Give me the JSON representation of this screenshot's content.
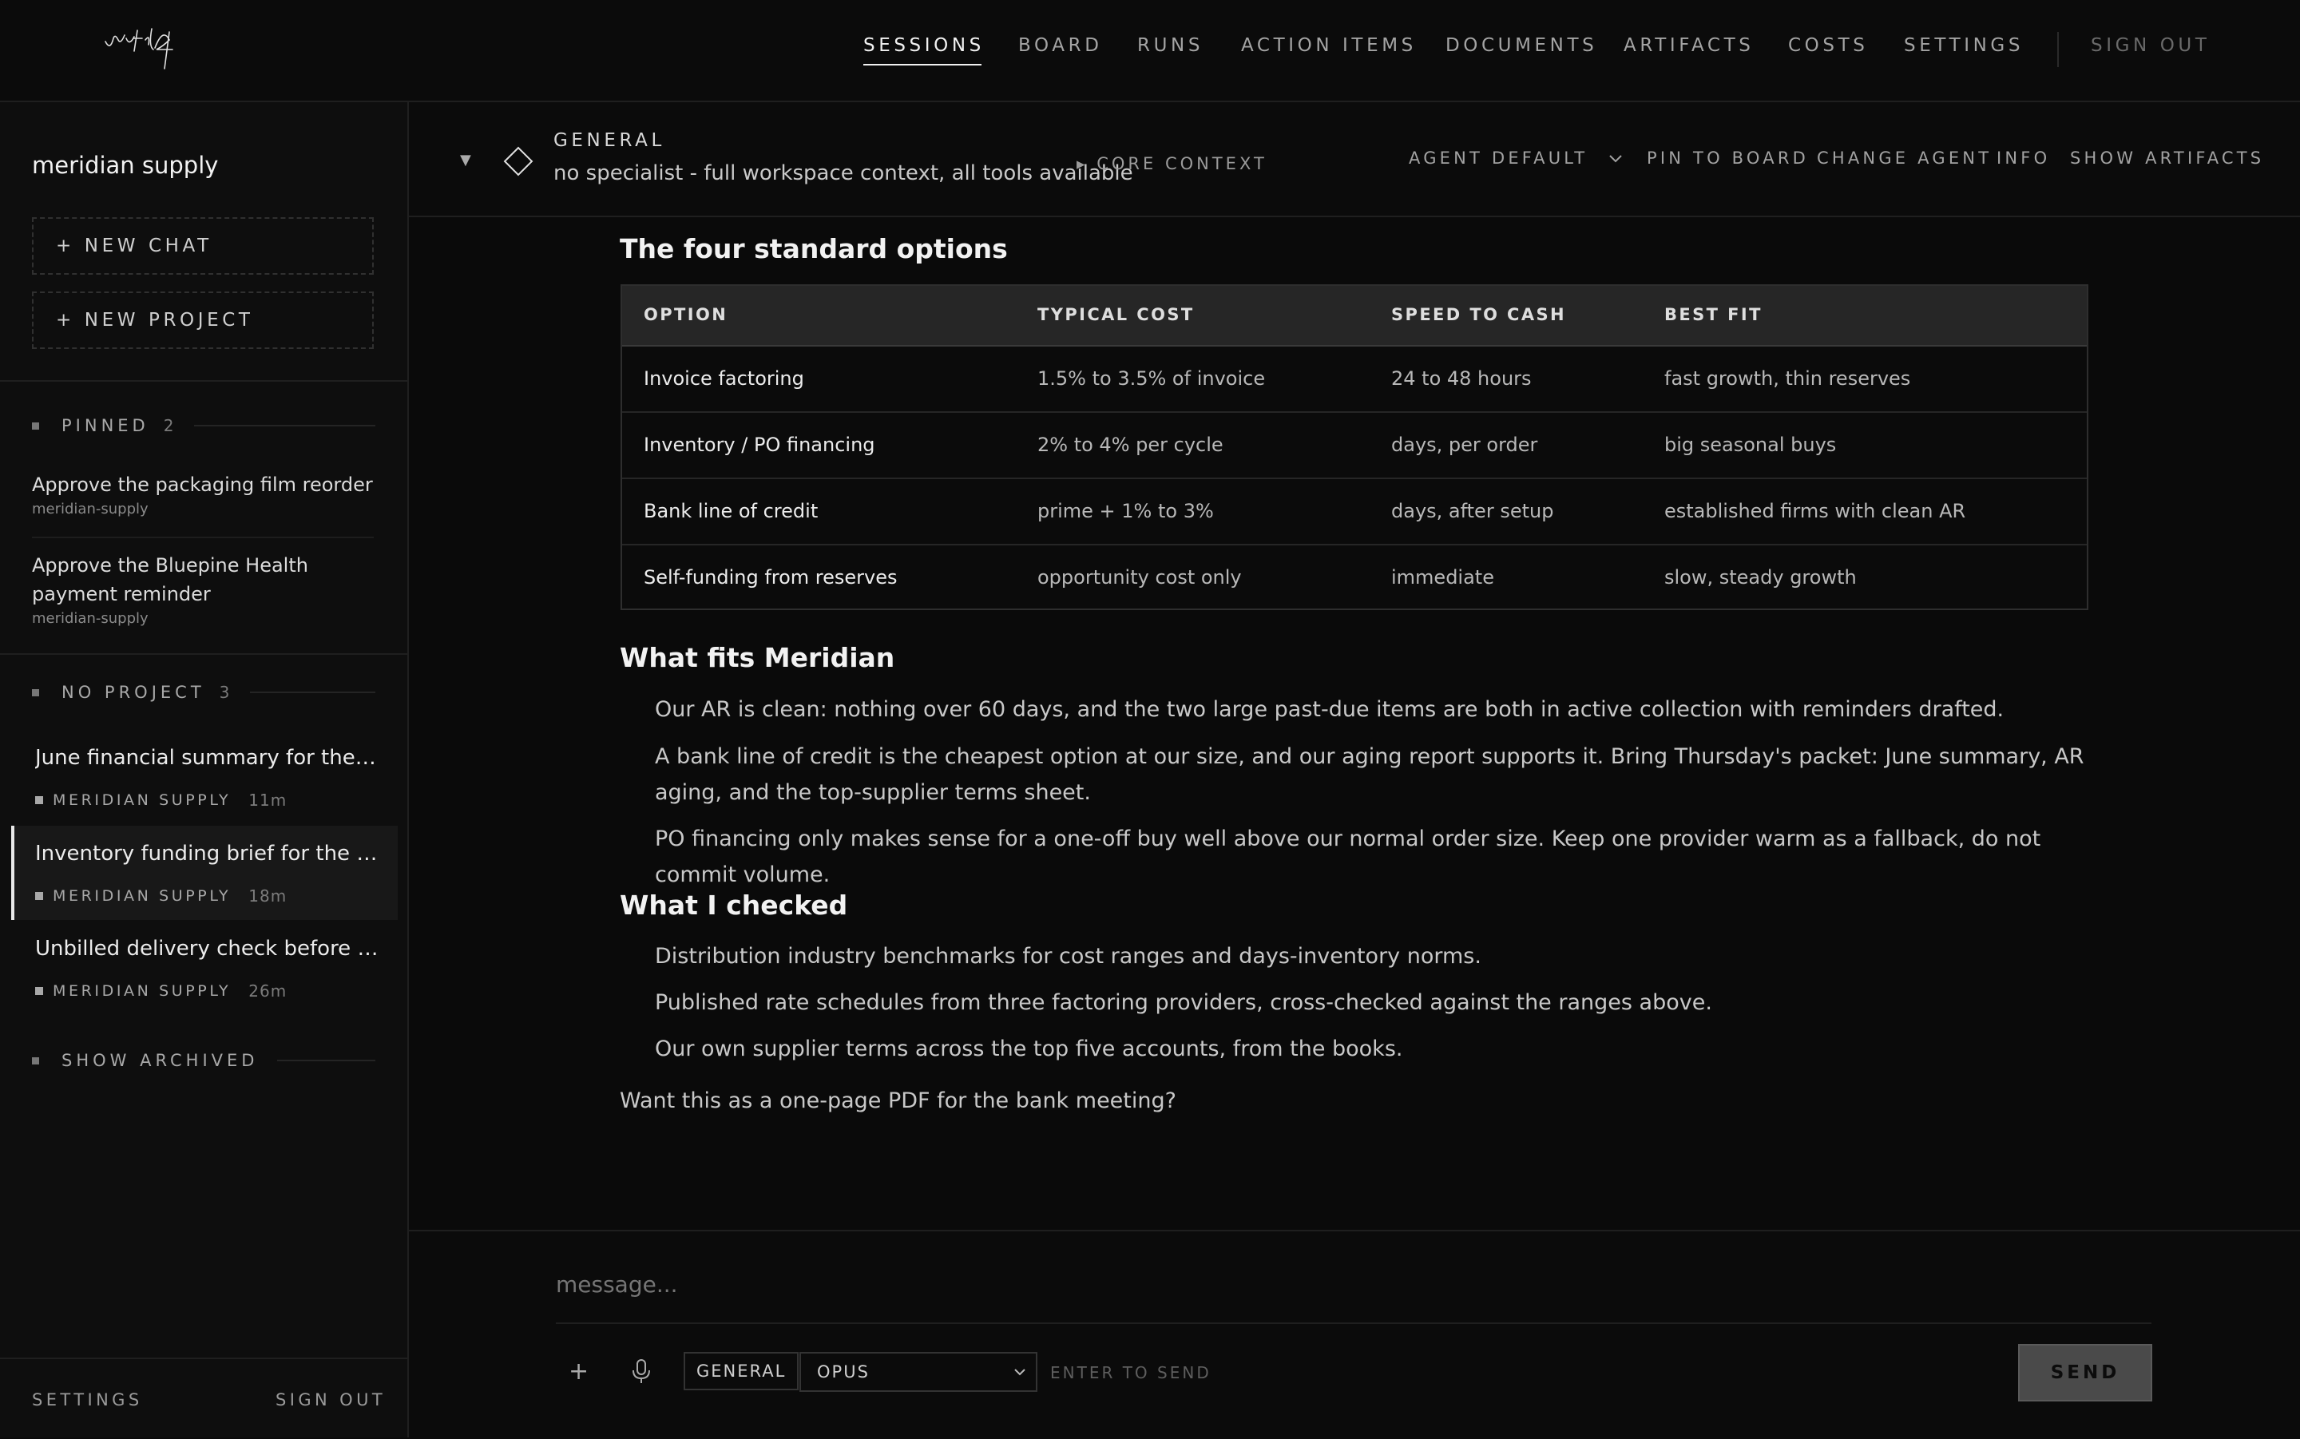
{
  "topnav": {
    "items": [
      "SESSIONS",
      "BOARD",
      "RUNS",
      "ACTION ITEMS",
      "DOCUMENTS",
      "ARTIFACTS",
      "COSTS",
      "SETTINGS"
    ],
    "active": "SESSIONS",
    "signout": "SIGN OUT"
  },
  "sidebar": {
    "workspace": "meridian supply",
    "new_chat": "+ NEW CHAT",
    "new_project": "+ NEW PROJECT",
    "pinned": {
      "label": "PINNED",
      "count": "2",
      "items": [
        {
          "title": "Approve the packaging film reorder",
          "sub": "meridian-supply"
        },
        {
          "title": "Approve the Bluepine Health payment reminder",
          "sub": "meridian-supply"
        }
      ]
    },
    "no_project": {
      "label": "NO PROJECT",
      "count": "3",
      "items": [
        {
          "title": "June financial summary for the lea...",
          "tag": "MERIDIAN SUPPLY",
          "age": "11m"
        },
        {
          "title": "Inventory funding brief for the ban...",
          "tag": "MERIDIAN SUPPLY",
          "age": "18m"
        },
        {
          "title": "Unbilled delivery check before Jun...",
          "tag": "MERIDIAN SUPPLY",
          "age": "26m"
        }
      ]
    },
    "show_archived": "SHOW ARCHIVED",
    "footer_settings": "SETTINGS",
    "footer_signout": "SIGN OUT"
  },
  "chat_header": {
    "title": "GENERAL",
    "subtitle": "no specialist - full workspace context, all tools available",
    "core_context": "▸ CORE CONTEXT",
    "agent_default": "AGENT DEFAULT",
    "pin_to_board": "PIN TO BOARD",
    "change_agent": "CHANGE AGENT",
    "info": "INFO",
    "show_artifacts": "SHOW ARTIFACTS"
  },
  "message": {
    "section1_title": "The four standard options",
    "table": {
      "headers": [
        "OPTION",
        "TYPICAL COST",
        "SPEED TO CASH",
        "BEST FIT"
      ],
      "rows": [
        [
          "Invoice factoring",
          "1.5% to 3.5% of invoice",
          "24 to 48 hours",
          "fast growth, thin reserves"
        ],
        [
          "Inventory / PO financing",
          "2% to 4% per cycle",
          "days, per order",
          "big seasonal buys"
        ],
        [
          "Bank line of credit",
          "prime + 1% to 3%",
          "days, after setup",
          "established firms with clean AR"
        ],
        [
          "Self-funding from reserves",
          "opportunity cost only",
          "immediate",
          "slow, steady growth"
        ]
      ]
    },
    "section2_title": "What fits Meridian",
    "section2_items": [
      "Our AR is clean: nothing over 60 days, and the two large past-due items are both in active collection with reminders drafted.",
      "A bank line of credit is the cheapest option at our size, and our aging report supports it. Bring Thursday's packet: June summary, AR aging, and the top-supplier terms sheet.",
      "PO financing only makes sense for a one-off buy well above our normal order size. Keep one provider warm as a fallback, do not commit volume."
    ],
    "section3_title": "What I checked",
    "section3_items": [
      "Distribution industry benchmarks for cost ranges and days-inventory norms.",
      "Published rate schedules from three factoring providers, cross-checked against the ranges above.",
      "Our own supplier terms across the top five accounts, from the books."
    ],
    "closing": "Want this as a one-page PDF for the bank meeting?"
  },
  "composer": {
    "placeholder": "message...",
    "agent_pill": "GENERAL",
    "model": "OPUS",
    "hint": "ENTER TO SEND",
    "send": "SEND"
  }
}
